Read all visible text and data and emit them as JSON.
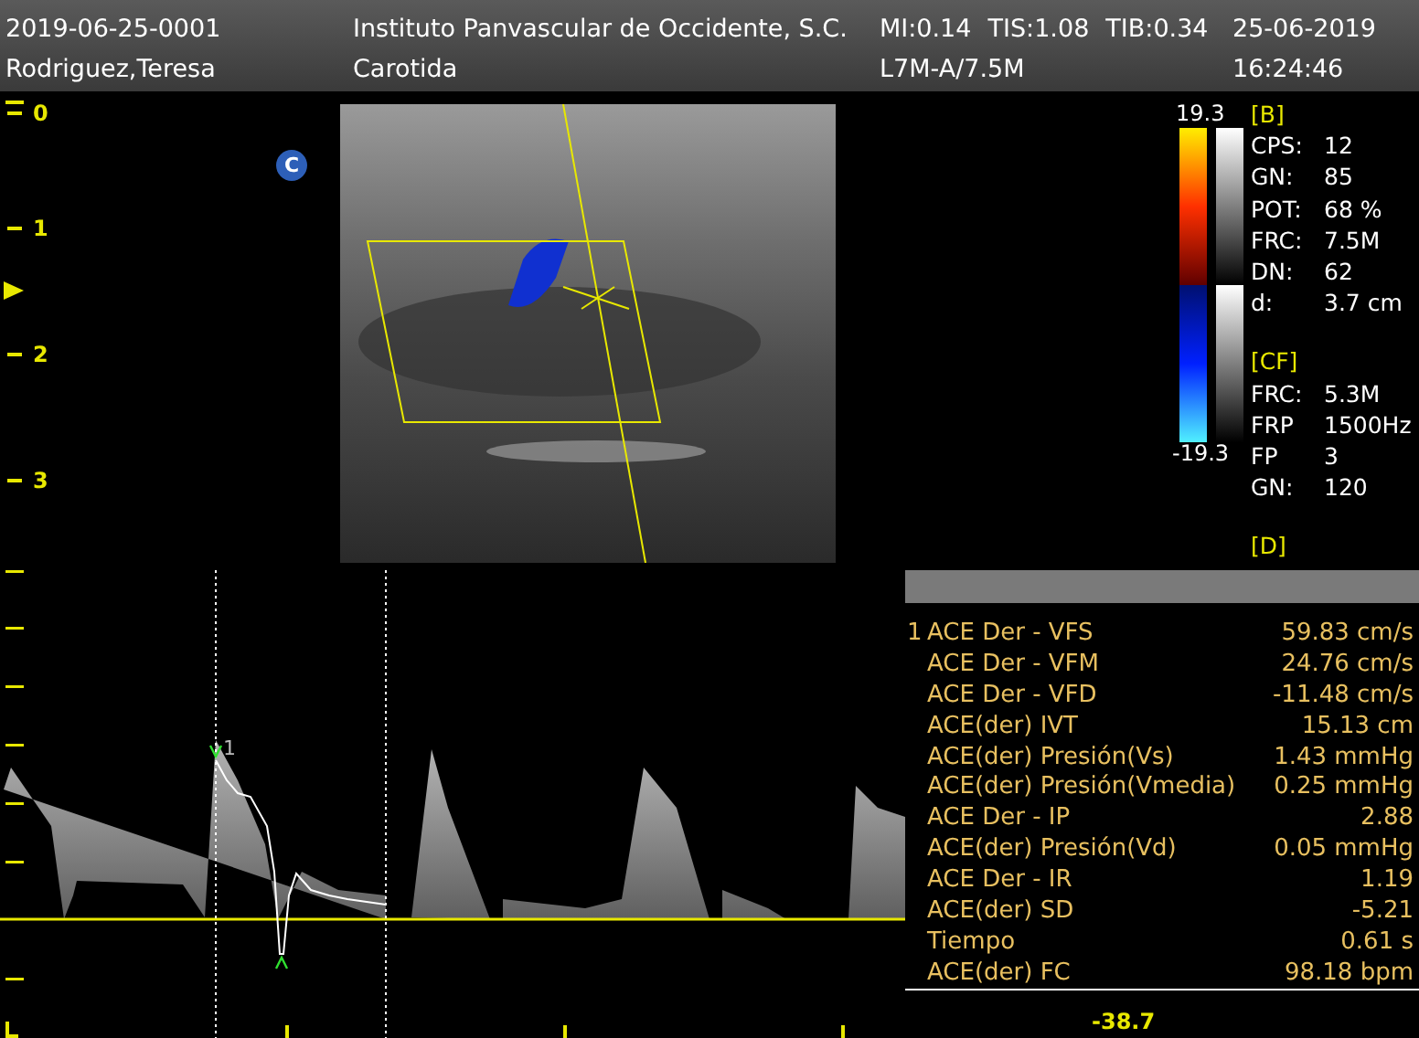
{
  "header": {
    "exam_id": "2019-06-25-0001",
    "institution": "Instituto Panvascular de Occidente, S.C.",
    "indices": [
      "MI:0.14",
      "TIS:1.08",
      "TIB:0.34"
    ],
    "date": "25-06-2019",
    "patient": "Rodriguez,Teresa",
    "exam_type": "Carotida",
    "probe": "L7M-A/7.5M",
    "time": "16:24:46"
  },
  "depth_scale": [
    "0",
    "1",
    "2",
    "3"
  ],
  "mode_badge": "C",
  "color_bar": {
    "max": "19.3",
    "min": "-19.3"
  },
  "params": [
    {
      "kind": "heading",
      "text": "[B]"
    },
    {
      "kind": "param",
      "label": "CPS:",
      "value": "12"
    },
    {
      "kind": "param",
      "label": "GN:",
      "value": "85"
    },
    {
      "kind": "param",
      "label": "POT:",
      "value": "68 %"
    },
    {
      "kind": "param",
      "label": "FRC:",
      "value": "7.5M"
    },
    {
      "kind": "param",
      "label": "DN:",
      "value": "62"
    },
    {
      "kind": "param",
      "label": "d:",
      "value": "3.7 cm"
    },
    {
      "kind": "heading",
      "text": "[CF]"
    },
    {
      "kind": "param",
      "label": "FRC:",
      "value": "5.3M"
    },
    {
      "kind": "param",
      "label": "FRP",
      "value": "1500Hz"
    },
    {
      "kind": "param",
      "label": "FP",
      "value": "3"
    },
    {
      "kind": "param",
      "label": "GN:",
      "value": "120"
    },
    {
      "kind": "heading",
      "text": "[D]"
    }
  ],
  "spectrum": {
    "cursor_label": "1",
    "baseline_value": "-38.7"
  },
  "measurements": [
    {
      "index": "1",
      "name": "ACE Der - VFS",
      "value": "59.83 cm/s"
    },
    {
      "name": "ACE Der - VFM",
      "value": "24.76 cm/s"
    },
    {
      "name": "ACE Der - VFD",
      "value": "-11.48 cm/s"
    },
    {
      "name": "ACE(der) IVT",
      "value": "15.13 cm"
    },
    {
      "name": "ACE(der) Presión(Vs)",
      "value": "1.43 mmHg"
    },
    {
      "name": "ACE(der) Presión(Vmedia)",
      "value": "0.25 mmHg"
    },
    {
      "name": "ACE Der - IP",
      "value": "2.88"
    },
    {
      "name": "ACE(der) Presión(Vd)",
      "value": "0.05 mmHg"
    },
    {
      "name": "ACE Der - IR",
      "value": "1.19"
    },
    {
      "name": "ACE(der) SD",
      "value": "-5.21"
    },
    {
      "name": "Tiempo",
      "value": "0.61 s"
    },
    {
      "name": "ACE(der) FC",
      "value": "98.18 bpm"
    }
  ]
}
